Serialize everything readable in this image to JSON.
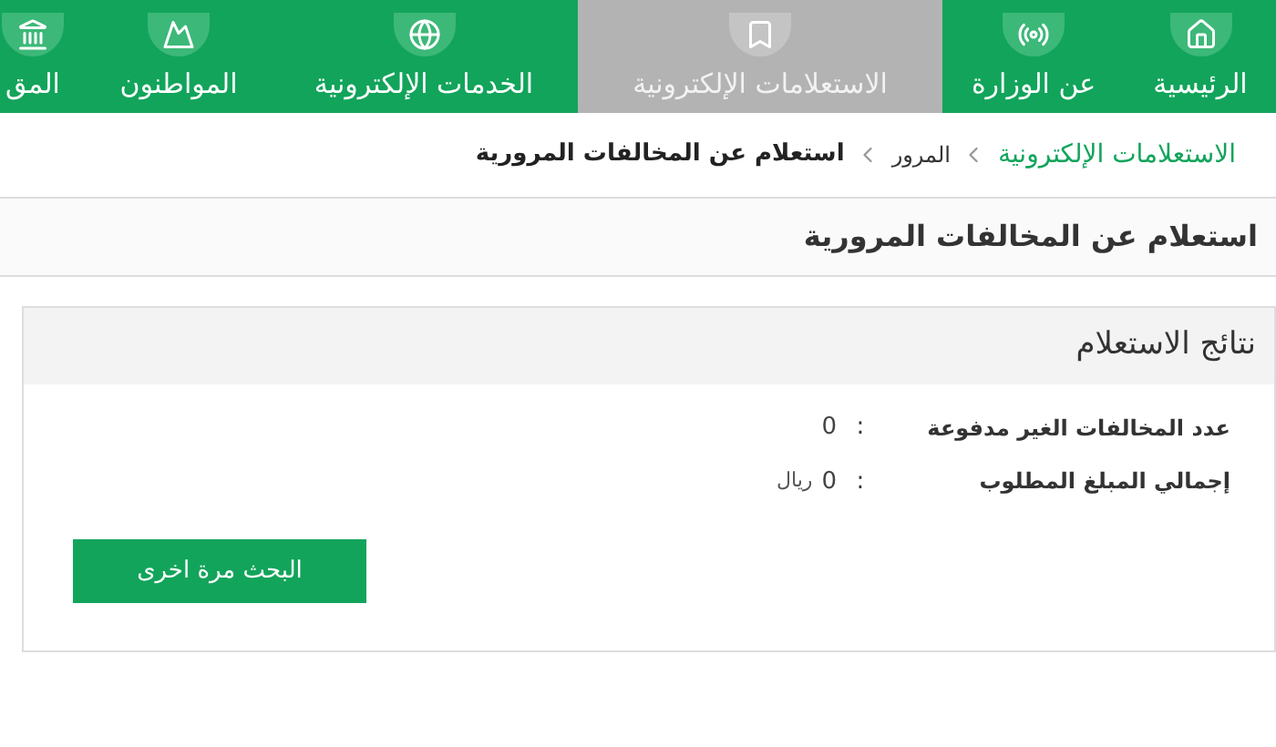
{
  "nav": [
    {
      "label": "الرئيسية",
      "selected": false
    },
    {
      "label": "عن الوزارة",
      "selected": false
    },
    {
      "label": "الاستعلامات الإلكترونية",
      "selected": true
    },
    {
      "label": "الخدمات الإلكترونية",
      "selected": false
    },
    {
      "label": "المواطنون",
      "selected": false
    },
    {
      "label": "المق",
      "selected": false
    }
  ],
  "breadcrumb": [
    {
      "label": "الاستعلامات الإلكترونية",
      "kind": "link"
    },
    {
      "label": "المرور",
      "kind": "plain"
    },
    {
      "label": "استعلام عن المخالفات المرورية",
      "kind": "current"
    }
  ],
  "page_title": "استعلام عن المخالفات المرورية",
  "results": {
    "title": "نتائج الاستعلام",
    "rows": [
      {
        "label": "عدد المخالفات الغير مدفوعة",
        "separator": ":",
        "value": "0"
      },
      {
        "label": "إجمالي المبلغ المطلوب",
        "separator": ":",
        "value": "0",
        "unit": "ريال"
      }
    ],
    "button": "البحث مرة اخرى"
  }
}
